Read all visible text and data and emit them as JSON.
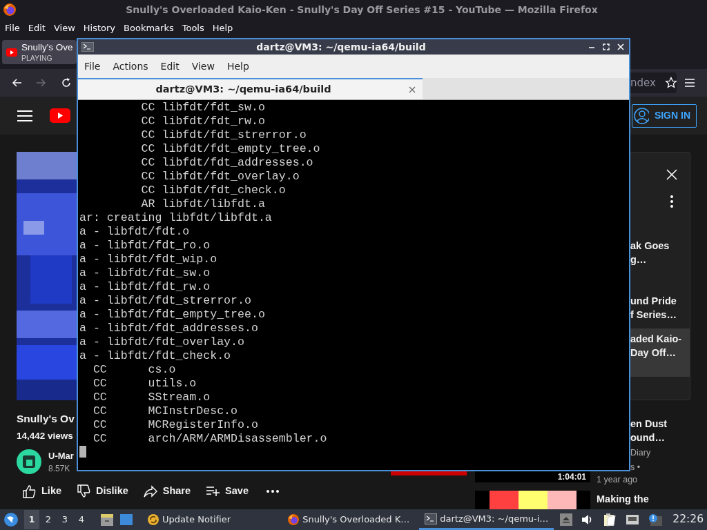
{
  "firefox": {
    "title": "Snully's Overloaded Kaio-Ken - Snully's Day Off Series #15 - YouTube — Mozilla Firefox",
    "menu": [
      "File",
      "Edit",
      "View",
      "History",
      "Bookmarks",
      "Tools",
      "Help"
    ],
    "tab": {
      "title": "Snully's Ove",
      "status": "PLAYING"
    },
    "nav": [
      {
        "kind": "back",
        "disabled": false
      },
      {
        "kind": "forward",
        "disabled": true
      },
      {
        "kind": "reload",
        "disabled": false
      }
    ],
    "address_fragment": "ndex"
  },
  "youtube": {
    "sign_in": "SIGN IN",
    "video": {
      "title": "Snully's Ov",
      "views": "14,442 views",
      "channel": "U-Mar",
      "subscribers": "8.57K"
    },
    "actions": [
      {
        "kind": "like",
        "label": "Like"
      },
      {
        "kind": "dislike",
        "label": "Dislike"
      },
      {
        "kind": "share",
        "label": "Share"
      },
      {
        "kind": "save",
        "label": "Save"
      }
    ],
    "playlist": [
      {
        "lines": [
          "ak Goes",
          "g…"
        ],
        "selected": false
      },
      {
        "lines": [
          "und Pride",
          "f Series…"
        ],
        "selected": false
      },
      {
        "lines": [
          "aded Kaio-",
          "Day Off…"
        ],
        "selected": true
      }
    ],
    "related": [
      {
        "title_lines": [
          "en Dust",
          "ound…"
        ],
        "meta_lines": [
          "Diary",
          "s •"
        ],
        "age": "1 year ago",
        "duration": "1:04:01"
      },
      {
        "title_lines": [
          "Making the"
        ]
      }
    ]
  },
  "terminal": {
    "title": "dartz@VM3: ~/qemu-ia64/build",
    "menu": [
      "File",
      "Actions",
      "Edit",
      "View",
      "Help"
    ],
    "tab": "dartz@VM3: ~/qemu-ia64/build",
    "lines": [
      "         CC libfdt/fdt_sw.o",
      "         CC libfdt/fdt_rw.o",
      "         CC libfdt/fdt_strerror.o",
      "         CC libfdt/fdt_empty_tree.o",
      "         CC libfdt/fdt_addresses.o",
      "         CC libfdt/fdt_overlay.o",
      "         CC libfdt/fdt_check.o",
      "         AR libfdt/libfdt.a",
      "ar: creating libfdt/libfdt.a",
      "a - libfdt/fdt.o",
      "a - libfdt/fdt_ro.o",
      "a - libfdt/fdt_wip.o",
      "a - libfdt/fdt_sw.o",
      "a - libfdt/fdt_rw.o",
      "a - libfdt/fdt_strerror.o",
      "a - libfdt/fdt_empty_tree.o",
      "a - libfdt/fdt_addresses.o",
      "a - libfdt/fdt_overlay.o",
      "a - libfdt/fdt_check.o",
      "  CC      cs.o",
      "  CC      utils.o",
      "  CC      SStream.o",
      "  CC      MCInstrDesc.o",
      "  CC      MCRegisterInfo.o",
      "  CC      arch/ARM/ARMDisassembler.o"
    ]
  },
  "taskbar": {
    "workspaces": [
      {
        "label": "1",
        "selected": true
      },
      {
        "label": "2",
        "selected": false
      },
      {
        "label": "3",
        "selected": false
      },
      {
        "label": "4",
        "selected": false
      }
    ],
    "tasks": [
      {
        "kind": "update",
        "label": "Update Notifier",
        "active": false
      },
      {
        "kind": "firefox",
        "label": "Snully's Overloaded K…",
        "active": false
      },
      {
        "kind": "terminal",
        "label": "dartz@VM3: ~/qemu-i…",
        "active": true
      }
    ],
    "clock": "22:26"
  }
}
